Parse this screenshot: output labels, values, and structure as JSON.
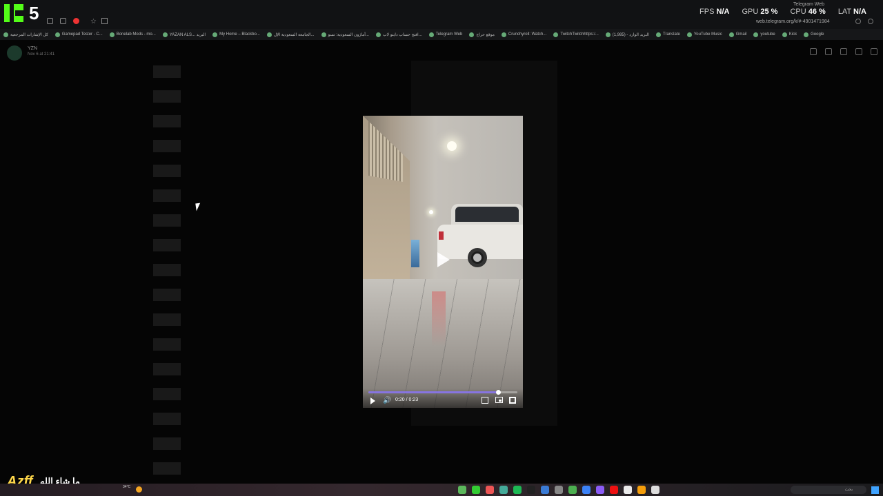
{
  "overlay": {
    "counter": "5",
    "stats": {
      "fps_label": "FPS",
      "fps_value": "N/A",
      "gpu_label": "GPU",
      "gpu_value": "25 %",
      "cpu_label": "CPU",
      "cpu_value": "46 %",
      "lat_label": "LAT",
      "lat_value": "N/A"
    },
    "watermark": "Azff",
    "arabic_caption": "ما شاء الله"
  },
  "browser": {
    "active_tab": "Telegram Web",
    "url": "web.telegram.org/k/#-4901471984",
    "bookmarks": [
      {
        "label": "كل الإشارات المرجعية"
      },
      {
        "label": "Gamepad Tester - C..."
      },
      {
        "label": "Bonelab Mods - mo..."
      },
      {
        "label": "YAZAN ALS... البريد"
      },
      {
        "label": "My Home – Blackbo..."
      },
      {
        "label": "الجامعة السعودية الإل..."
      },
      {
        "label": "أماژون السعودية: تسو..."
      },
      {
        "label": "افتح حساب دايتو لاب..."
      },
      {
        "label": "Telegram Web"
      },
      {
        "label": "موقع حراج"
      },
      {
        "label": "Crunchyroll: Watch..."
      },
      {
        "label": "TwitchTwitchhttps:/..."
      },
      {
        "label": "(1,985) - البريد الوارد"
      },
      {
        "label": "Translate"
      },
      {
        "label": "YouTube Music"
      },
      {
        "label": "Gmail"
      },
      {
        "label": "youtube"
      },
      {
        "label": "Kick"
      },
      {
        "label": "Google"
      }
    ]
  },
  "viewer": {
    "sender": "YZN",
    "date": "Nov 6 at 21:41",
    "video": {
      "time": "0:20 / 0:23",
      "progress": 0.87
    }
  },
  "taskbar": {
    "weather_temp": "34°C",
    "search_placeholder": "بحث"
  },
  "colors": {
    "accent": "#8774e1",
    "kick_green": "#53fc18",
    "watermark_yellow": "#ffd84a"
  }
}
